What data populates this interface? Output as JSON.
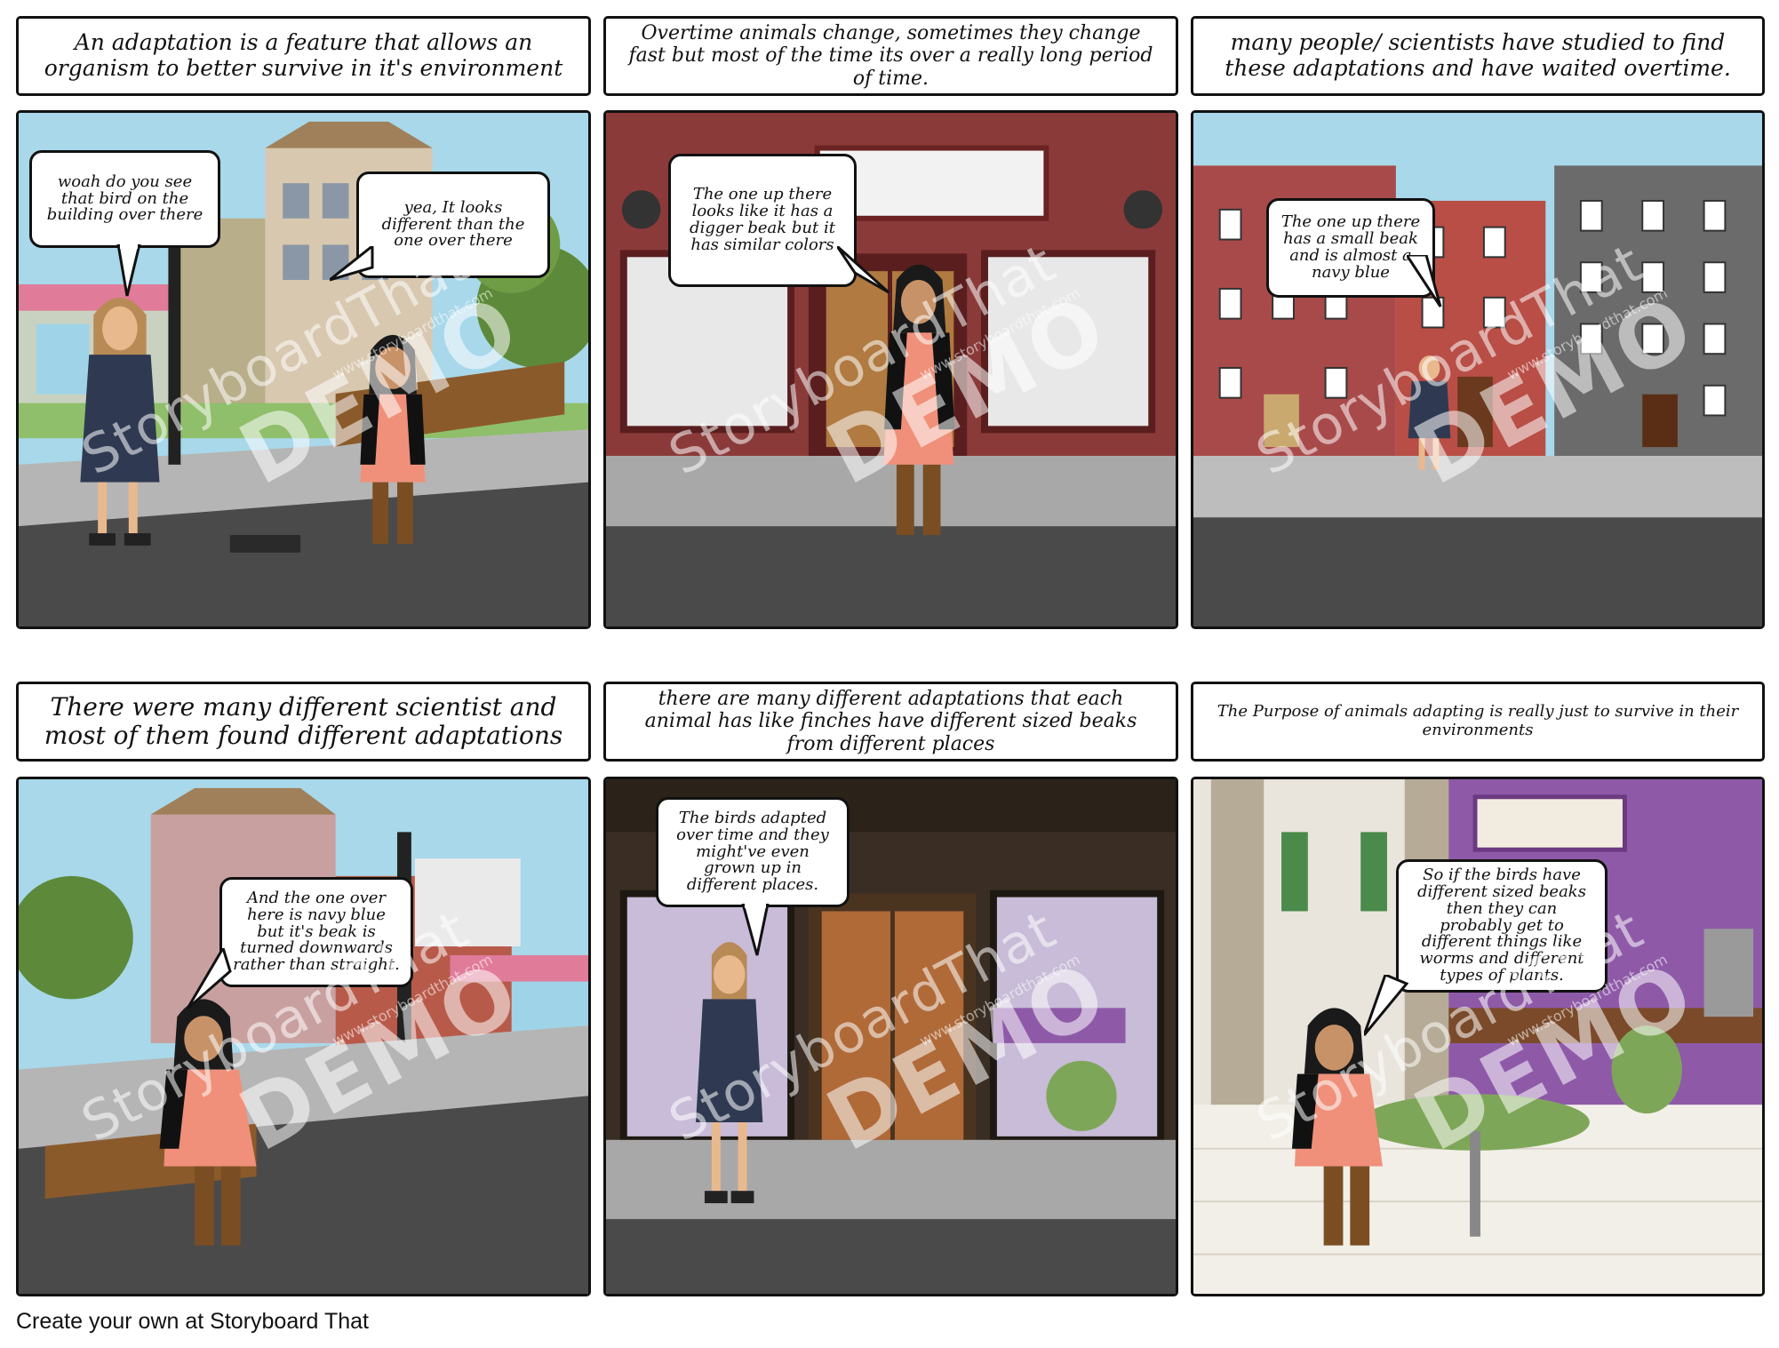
{
  "captions": [
    "An adaptation is a feature that allows an organism to better survive in it's environment",
    "Overtime animals change, sometimes they change fast but most of the time its over a really long period of time.",
    "many people/ scientists have studied to find these adaptations and have waited overtime.",
    "There were many different scientist and most of them found different adaptations",
    "there are many different adaptations that each animal has like finches have different sized beaks from different places",
    "The Purpose of animals adapting is really just to survive in their environments"
  ],
  "bubbles": {
    "p1a": "woah do you see that bird on the building over there",
    "p1b": "yea, It looks different than the one over there",
    "p2": "The one up there looks like it has a digger beak but it has similar colors",
    "p3": "The one up there has a small beak and is almost a navy blue",
    "p4": "And the one over here is navy blue but it's beak is turned downwards rather than straight.",
    "p5": "The birds adapted over time and they might've even grown up in different places.",
    "p6": "So if the birds have different sized beaks then they can probably get to different things like worms and different types of plants."
  },
  "watermark": {
    "brand": "StoryboardThat",
    "demo": "DEMO",
    "url": "www.storyboardthat.com"
  },
  "footer": "Create your own at Storyboard That",
  "colors": {
    "border": "#111111",
    "sky": "#a8d8ea",
    "road": "#4a4a4a",
    "sidewalk": "#b5b5b5",
    "brick": "#8b3a3a",
    "purple": "#8e5aa8",
    "dress_coral": "#f0907a",
    "dress_navy": "#2f3a52"
  }
}
